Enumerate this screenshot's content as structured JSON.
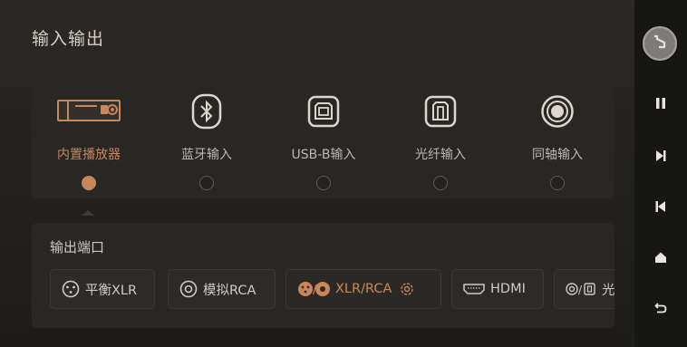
{
  "page": {
    "title": "输入输出"
  },
  "inputs": {
    "selected": "内置播放器",
    "items": [
      {
        "label": "内置播放器",
        "icon": "built-in-player-icon",
        "active": true
      },
      {
        "label": "蓝牙输入",
        "icon": "bluetooth-icon",
        "active": false
      },
      {
        "label": "USB-B输入",
        "icon": "usb-b-icon",
        "active": false
      },
      {
        "label": "光纤输入",
        "icon": "optical-icon",
        "active": false
      },
      {
        "label": "同轴输入",
        "icon": "coaxial-icon",
        "active": false
      }
    ]
  },
  "outputs": {
    "title": "输出端口",
    "ports": [
      {
        "label": "平衡XLR",
        "icon": "xlr-icon",
        "active": false
      },
      {
        "label": "模拟RCA",
        "icon": "rca-icon",
        "active": false
      },
      {
        "label": "XLR/RCA",
        "icon": "xlr-rca-icon",
        "active": true
      },
      {
        "label": "HDMI",
        "icon": "hdmi-icon",
        "active": false
      },
      {
        "label": "光",
        "icon": "coax-optical-icon",
        "active": false
      }
    ]
  },
  "colors": {
    "accent": "#c9865a",
    "background": "#23211e",
    "sidebar": "#161615"
  },
  "sidebar": {
    "buttons": [
      "avatar-icon",
      "pause-icon",
      "next-icon",
      "previous-icon",
      "home-icon",
      "back-icon"
    ]
  }
}
